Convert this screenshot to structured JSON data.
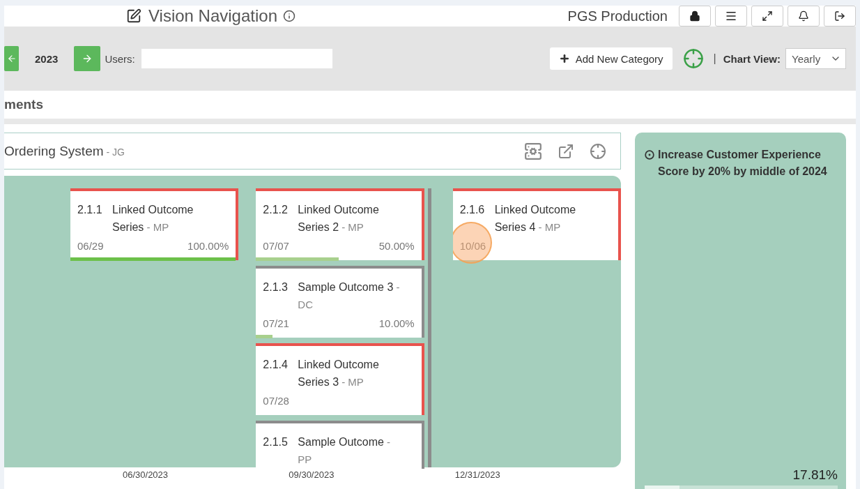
{
  "header": {
    "title": "Vision Navigation",
    "org": "PGS Production"
  },
  "toolbar": {
    "year": "2023",
    "users_label": "Users:",
    "add_button": "Add New Category",
    "separator": "|",
    "chart_view_label": "Chart View:",
    "chart_view": "Yearly"
  },
  "section": {
    "title": "ments"
  },
  "category": {
    "title": "Ordering System",
    "owner": " - JG"
  },
  "columns": [
    {
      "cards": [
        {
          "number": "2.1.1",
          "title": "Linked Outcome Series",
          "owner": " - MP",
          "date": "06/29",
          "percent": "100.00%",
          "level": 1,
          "color": "#e8534d"
        }
      ]
    },
    {
      "cards": [
        {
          "number": "2.1.2",
          "title": "Linked Outcome Series 2",
          "owner": " - MP",
          "date": "07/07",
          "percent": "50.00%",
          "level": 0.5,
          "color": "#e8534d"
        },
        {
          "number": "2.1.3",
          "title": "Sample Outcome 3",
          "owner": " - DC",
          "date": "07/21",
          "percent": "10.00%",
          "level": 0.1,
          "color": "#8c8c8c"
        },
        {
          "number": "2.1.4",
          "title": "Linked Outcome Series 3",
          "owner": " - MP",
          "date": "07/28",
          "color": "#e8534d"
        },
        {
          "number": "2.1.5",
          "title": "Sample Outcome",
          "owner": " - PP",
          "color": "#8c8c8c"
        }
      ]
    },
    {
      "cards": [
        {
          "number": "2.1.6",
          "title": "Linked Outcome Series 4",
          "owner": " - MP",
          "date": "10/06",
          "color": "#e8534d"
        }
      ]
    }
  ],
  "axis_dates": [
    "06/30/2023",
    "09/30/2023",
    "12/31/2023"
  ],
  "goal": {
    "title": "Increase Customer Experience Score by 20% by middle of 2024",
    "percent": "17.81%",
    "level": 0.18
  }
}
